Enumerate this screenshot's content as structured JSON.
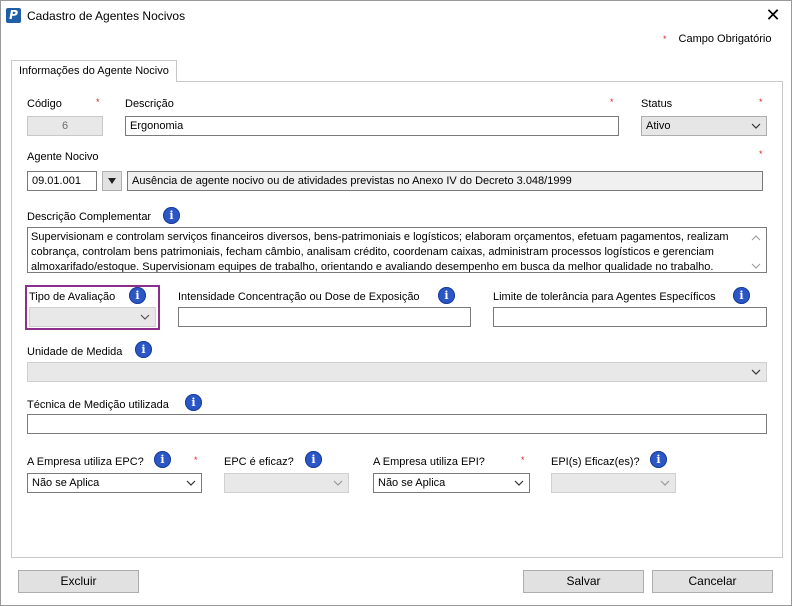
{
  "window": {
    "title": "Cadastro de Agentes Nocivos",
    "app_icon_letter": "P",
    "close_glyph": "✕"
  },
  "legend": {
    "star": "*",
    "text": "Campo Obrigatório"
  },
  "tabs": [
    {
      "label": "Informações do Agente Nocivo",
      "active": true
    }
  ],
  "form": {
    "codigo": {
      "label": "Código",
      "value": "6"
    },
    "descricao": {
      "label": "Descrição",
      "value": "Ergonomia"
    },
    "status": {
      "label": "Status",
      "value": "Ativo"
    },
    "agente_nocivo": {
      "label": "Agente Nocivo",
      "code": "09.01.001",
      "description": "Ausência de agente nocivo ou de atividades previstas no Anexo IV do Decreto 3.048/1999"
    },
    "descricao_complementar": {
      "label": "Descrição Complementar",
      "value": "Supervisionam e controlam serviços financeiros diversos, bens-patrimoniais e logísticos; elaboram orçamentos, efetuam pagamentos, realizam cobrança, controlam bens patrimoniais, fecham câmbio, analisam crédito, coordenam caixas, administram processos logísticos e gerenciam almoxarifado/estoque. Supervisionam equipes de trabalho, orientando e avaliando desempenho em busca da melhor qualidade no trabalho."
    },
    "tipo_avaliacao": {
      "label": "Tipo de Avaliação",
      "value": ""
    },
    "intensidade": {
      "label": "Intensidade Concentração ou Dose de Exposição",
      "value": ""
    },
    "limite_tolerancia": {
      "label": "Limite de tolerância para Agentes Específicos",
      "value": ""
    },
    "unidade_medida": {
      "label": "Unidade de Medida",
      "value": ""
    },
    "tecnica_medicao": {
      "label": "Técnica de Medição utilizada",
      "value": ""
    },
    "empresa_epc": {
      "label": "A Empresa utiliza EPC?",
      "value": "Não se Aplica"
    },
    "epc_eficaz": {
      "label": "EPC é eficaz?",
      "value": ""
    },
    "empresa_epi": {
      "label": "A Empresa utiliza EPI?",
      "value": "Não se Aplica"
    },
    "epi_eficaz": {
      "label": "EPI(s) Eficaz(es)?",
      "value": ""
    },
    "required_star": "*",
    "info_glyph": "i"
  },
  "buttons": {
    "excluir": "Excluir",
    "salvar": "Salvar",
    "cancelar": "Cancelar"
  },
  "colors": {
    "accent_info": "#2a56c6",
    "required": "#e02020",
    "highlight": "#8b2f8b"
  }
}
